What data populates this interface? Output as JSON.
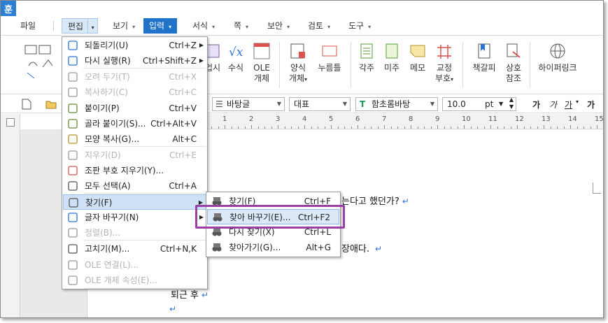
{
  "app": {
    "icon_glyph": "훈"
  },
  "menubar": {
    "file": "파일",
    "edit": "편집",
    "view": "보기",
    "input": "입력",
    "format": "서식",
    "page": "쪽",
    "security": "보안",
    "review": "검토",
    "tools": "도구"
  },
  "ribbon": {
    "formula_partial": "업시",
    "formula": "수식",
    "ole_line1": "OLE",
    "ole_line2": "개체",
    "ole_icon_text": "OLE",
    "form_line1": "양식",
    "form_line2": "개체",
    "button": "누름틀",
    "footnote": "각주",
    "endnote": "미주",
    "memo": "메모",
    "revision_line1": "교정",
    "revision_line2": "부호",
    "bookmark": "책갈피",
    "crossref_line1": "상호",
    "crossref_line2": "참조",
    "hyperlink": "하이퍼링크"
  },
  "formatbar": {
    "style": "바탕글",
    "lang": "대표",
    "font": "함초롬바탕",
    "size": "10.0",
    "unit": "pt",
    "bold": "가",
    "italic": "가",
    "underline": "가",
    "strike": "가"
  },
  "document": {
    "line1": "는다고 했던가?",
    "line2": "장애다.",
    "line3": "퇴근 후",
    "para_mark": "↵"
  },
  "edit_menu": [
    {
      "label": "되돌리기(U)",
      "shortcut": "Ctrl+Z",
      "disabled": false
    },
    {
      "label": "다시 실행(R)",
      "shortcut": "Ctrl+Shift+Z",
      "disabled": false
    },
    {
      "label": "오려 두기(T)",
      "shortcut": "Ctrl+X",
      "disabled": true
    },
    {
      "label": "복사하기(C)",
      "shortcut": "Ctrl+C",
      "disabled": true
    },
    {
      "label": "붙이기(P)",
      "shortcut": "Ctrl+V",
      "disabled": false
    },
    {
      "label": "골라 붙이기(S)...",
      "shortcut": "Ctrl+Alt+V",
      "disabled": false
    },
    {
      "label": "모양 복사(G)...",
      "shortcut": "Alt+C",
      "disabled": false
    },
    {
      "label": "지우기(D)",
      "shortcut": "Ctrl+E",
      "disabled": true
    },
    {
      "label": "조판 부호 지우기(Y)...",
      "shortcut": "",
      "disabled": false
    },
    {
      "label": "모두 선택(A)",
      "shortcut": "Ctrl+A",
      "disabled": false
    },
    {
      "label": "찾기(F)",
      "shortcut": "",
      "disabled": false
    },
    {
      "label": "글자 바꾸기(N)",
      "shortcut": "",
      "disabled": false
    },
    {
      "label": "정렬(B)...",
      "shortcut": "",
      "disabled": true
    },
    {
      "label": "고치기(M)...",
      "shortcut": "Ctrl+N,K",
      "disabled": false
    },
    {
      "label": "OLE 연결(L)...",
      "shortcut": "",
      "disabled": true
    },
    {
      "label": "OLE 개체 속성(E)...",
      "shortcut": "",
      "disabled": true
    }
  ],
  "find_submenu": [
    {
      "label": "찾기(F)",
      "shortcut": "Ctrl+F"
    },
    {
      "label": "찾아 바꾸기(E)...",
      "shortcut": "Ctrl+F2"
    },
    {
      "label": "다시 찾기(X)",
      "shortcut": "Ctrl+L"
    },
    {
      "label": "찾아가기(G)...",
      "shortcut": "Alt+G"
    }
  ],
  "ruler_numbers": [
    "1",
    "2",
    "3",
    "4",
    "5",
    "6",
    "7",
    "8",
    "9",
    "10",
    "11",
    "12",
    "13",
    "14",
    "15"
  ]
}
